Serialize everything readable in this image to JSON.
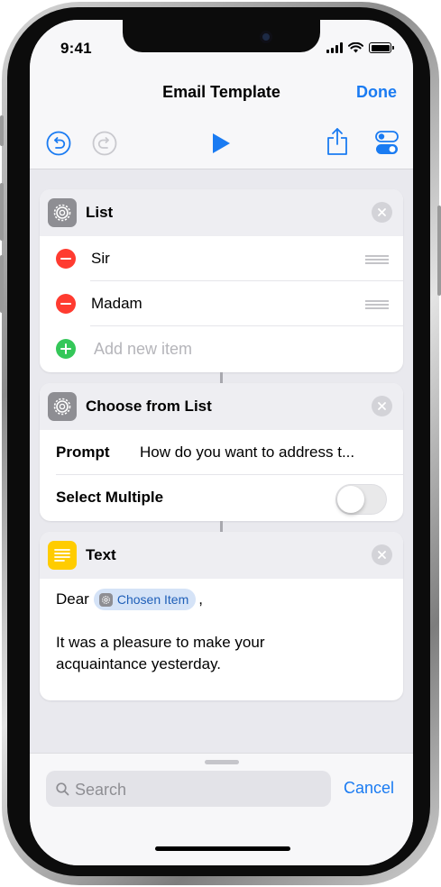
{
  "status_bar": {
    "time": "9:41"
  },
  "nav": {
    "title": "Email Template",
    "done_label": "Done"
  },
  "toolbar": {
    "icons": [
      "undo-icon",
      "redo-icon",
      "play-icon",
      "share-icon",
      "settings-toggle-icon"
    ],
    "accent_color": "#1a7bf2"
  },
  "list_action": {
    "title": "List",
    "icon": "gear-icon",
    "items": [
      {
        "label": "Sir"
      },
      {
        "label": "Madam"
      }
    ],
    "add_placeholder": "Add new item"
  },
  "choose_action": {
    "title": "Choose from List",
    "icon": "gear-icon",
    "prompt_label": "Prompt",
    "prompt_value": "How do you want to address t...",
    "multiple_label": "Select Multiple",
    "multiple_enabled": false
  },
  "text_action": {
    "title": "Text",
    "icon": "text-lines-icon",
    "greeting": "Dear",
    "variable_label": "Chosen Item",
    "after_variable": ",",
    "body": "It was a pleasure to make your acquaintance yesterday."
  },
  "search": {
    "placeholder": "Search",
    "cancel_label": "Cancel"
  }
}
